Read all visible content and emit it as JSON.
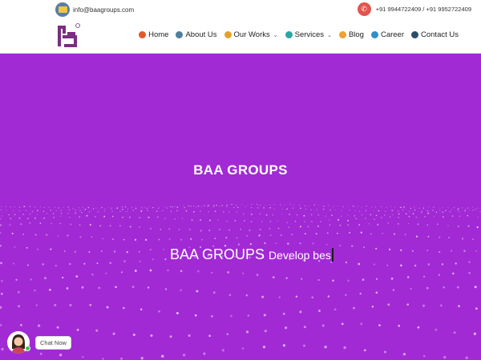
{
  "topbar": {
    "email": "info@baagroups.com",
    "phones": "+91 9944722409 / +91 9952722409",
    "mail_icon": "mail-icon",
    "phone_icon": "phone-icon"
  },
  "nav": {
    "items": [
      {
        "label": "Home",
        "icon": "home-icon",
        "color": "#e25a2a",
        "dropdown": false
      },
      {
        "label": "About Us",
        "icon": "about-icon",
        "color": "#4f7f9c",
        "dropdown": false
      },
      {
        "label": "Our Works",
        "icon": "works-icon",
        "color": "#e2a22a",
        "dropdown": true
      },
      {
        "label": "Services",
        "icon": "services-icon",
        "color": "#29a6a6",
        "dropdown": true
      },
      {
        "label": "Blog",
        "icon": "blog-icon",
        "color": "#f0a030",
        "dropdown": false
      },
      {
        "label": "Career",
        "icon": "career-icon",
        "color": "#2f8fc8",
        "dropdown": false
      },
      {
        "label": "Contact Us",
        "icon": "contact-icon",
        "color": "#2a4d6b",
        "dropdown": false
      }
    ]
  },
  "hero": {
    "title": "BAA GROUPS",
    "type_brand": "BAA GROUPS",
    "type_text": "Develop bes"
  },
  "chat": {
    "label": "Chat Now"
  },
  "colors": {
    "hero_bg": "#a12ad4",
    "logo": "#7a2d82"
  }
}
